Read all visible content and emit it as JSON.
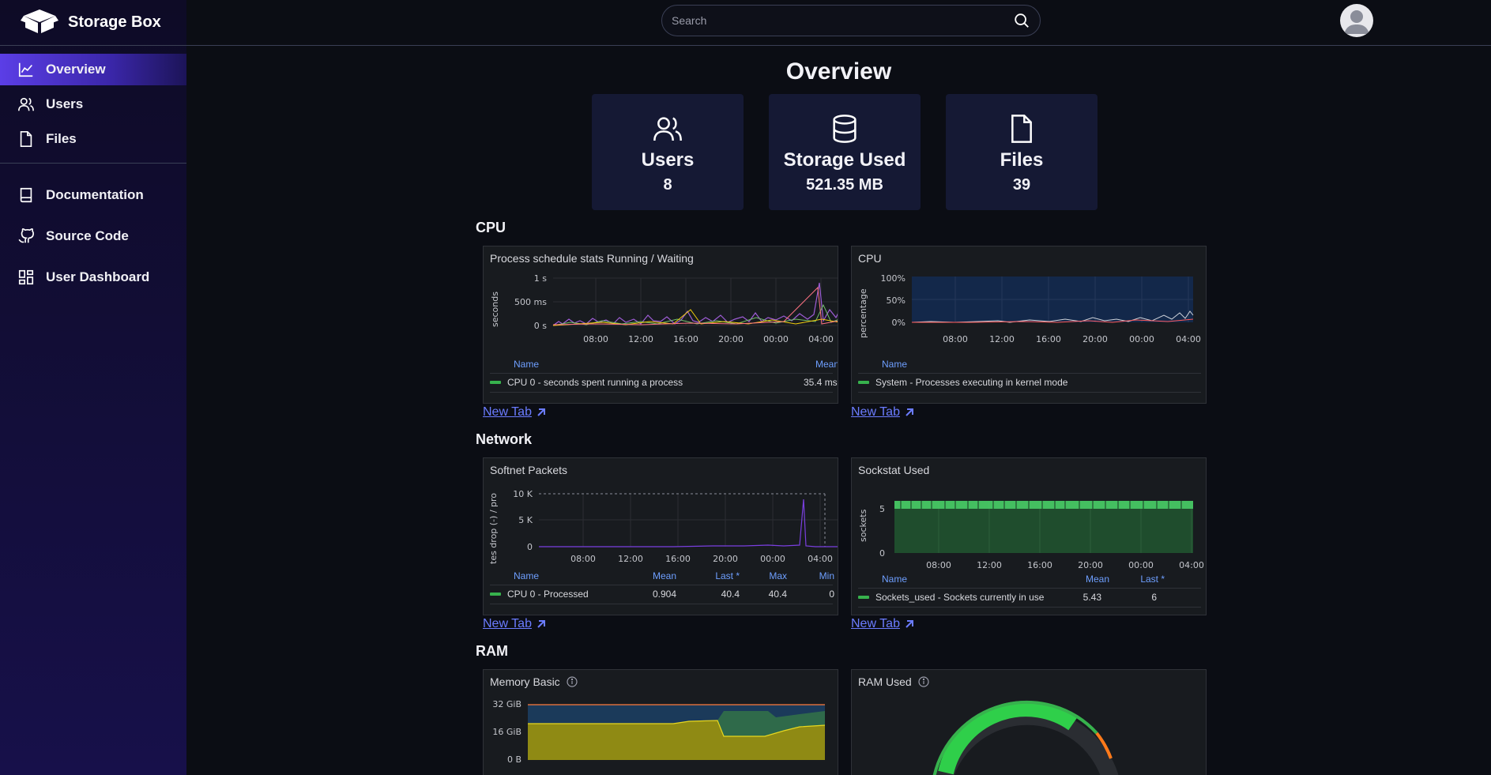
{
  "brand": {
    "name": "Storage Box"
  },
  "sidebar": {
    "items": [
      {
        "label": "Overview"
      },
      {
        "label": "Users"
      },
      {
        "label": "Files"
      }
    ],
    "links": [
      {
        "label": "Documentation"
      },
      {
        "label": "Source Code"
      },
      {
        "label": "User Dashboard"
      }
    ]
  },
  "search": {
    "placeholder": "Search"
  },
  "page": {
    "title": "Overview"
  },
  "stats": [
    {
      "label": "Users",
      "value": "8"
    },
    {
      "label": "Storage Used",
      "value": "521.35 MB"
    },
    {
      "label": "Files",
      "value": "39"
    }
  ],
  "sections": {
    "cpu": "CPU",
    "network": "Network",
    "ram": "RAM"
  },
  "x_ticks": [
    "08:00",
    "12:00",
    "16:00",
    "20:00",
    "00:00",
    "04:00"
  ],
  "panels": {
    "sched": {
      "title": "Process schedule stats Running / Waiting",
      "ylabel": "seconds",
      "yticks": [
        "1 s",
        "500 ms",
        "0 s"
      ],
      "legend_headers": {
        "name": "Name",
        "mean": "Mean"
      },
      "legend": {
        "name": "CPU 0 - seconds spent running a process",
        "mean": "35.4 ms"
      }
    },
    "cpu": {
      "title": "CPU",
      "ylabel": "percentage",
      "yticks": [
        "100%",
        "50%",
        "0%"
      ],
      "legend_headers": {
        "name": "Name"
      },
      "legend": {
        "name": "System - Processes executing in kernel mode"
      }
    },
    "softnet": {
      "title": "Softnet Packets",
      "ylabel": "tes drop (-) / pro",
      "yticks": [
        "10 K",
        "5 K",
        "0"
      ],
      "legend_headers": {
        "name": "Name",
        "mean": "Mean",
        "last": "Last *",
        "max": "Max",
        "min": "Min"
      },
      "legend": {
        "name": "CPU 0 - Processed",
        "mean": "0.904",
        "last": "40.4",
        "max": "40.4",
        "min": "0"
      }
    },
    "sockstat": {
      "title": "Sockstat Used",
      "ylabel": "sockets",
      "yticks": [
        "5",
        "0"
      ],
      "legend_headers": {
        "name": "Name",
        "mean": "Mean",
        "last": "Last *"
      },
      "legend": {
        "name": "Sockets_used - Sockets currently in use",
        "mean": "5.43",
        "last": "6"
      }
    },
    "memory": {
      "title": "Memory Basic",
      "yticks": [
        "32 GiB",
        "16 GiB",
        "0 B"
      ]
    },
    "ram": {
      "title": "RAM Used"
    }
  },
  "newtab": {
    "label": "New Tab"
  },
  "colors": {
    "accent": "#5b3ee6",
    "link": "#6b7cff",
    "series_green": "#37b24d",
    "panel_bg": "#181b1f"
  }
}
